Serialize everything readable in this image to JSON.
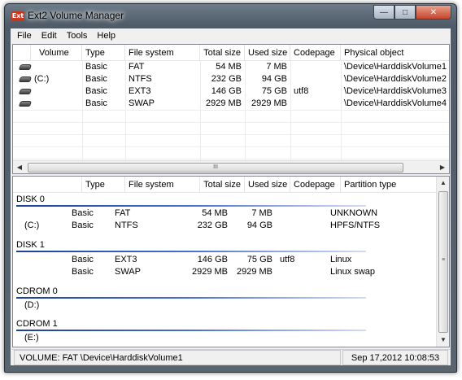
{
  "window": {
    "title": "Ext2 Volume Manager",
    "icon": "ext2-app-icon"
  },
  "caption_buttons": {
    "minimize": "—",
    "maximize": "□",
    "close": "✕"
  },
  "menu": [
    "File",
    "Edit",
    "Tools",
    "Help"
  ],
  "volumes": {
    "columns": [
      "Volume",
      "Type",
      "File system",
      "Total size",
      "Used size",
      "Codepage",
      "Physical object"
    ],
    "rows": [
      {
        "volume": "",
        "type": "Basic",
        "fs": "FAT",
        "total": "54 MB",
        "used": "7 MB",
        "codepage": "",
        "physical": "\\Device\\HarddiskVolume1"
      },
      {
        "volume": "(C:)",
        "type": "Basic",
        "fs": "NTFS",
        "total": "232 GB",
        "used": "94 GB",
        "codepage": "",
        "physical": "\\Device\\HarddiskVolume2"
      },
      {
        "volume": "",
        "type": "Basic",
        "fs": "EXT3",
        "total": "146 GB",
        "used": "75 GB",
        "codepage": "utf8",
        "physical": "\\Device\\HarddiskVolume3"
      },
      {
        "volume": "",
        "type": "Basic",
        "fs": "SWAP",
        "total": "2929 MB",
        "used": "2929 MB",
        "codepage": "",
        "physical": "\\Device\\HarddiskVolume4"
      }
    ],
    "scroll_grip": "III"
  },
  "disks": {
    "columns": [
      "",
      "Type",
      "File system",
      "Total size",
      "Used size",
      "Codepage",
      "Partition type"
    ],
    "groups": [
      {
        "label": "DISK 0",
        "rows": [
          {
            "vol": "",
            "type": "Basic",
            "fs": "FAT",
            "total": "54 MB",
            "used": "7 MB",
            "codepage": "",
            "ptype": "UNKNOWN"
          },
          {
            "vol": "(C:)",
            "type": "Basic",
            "fs": "NTFS",
            "total": "232 GB",
            "used": "94 GB",
            "codepage": "",
            "ptype": "HPFS/NTFS"
          }
        ]
      },
      {
        "label": "DISK 1",
        "rows": [
          {
            "vol": "",
            "type": "Basic",
            "fs": "EXT3",
            "total": "146 GB",
            "used": "75 GB",
            "codepage": "utf8",
            "ptype": "Linux"
          },
          {
            "vol": "",
            "type": "Basic",
            "fs": "SWAP",
            "total": "2929 MB",
            "used": "2929 MB",
            "codepage": "",
            "ptype": "Linux swap"
          }
        ]
      },
      {
        "label": "CDROM 0",
        "rows": [
          {
            "vol": "(D:)",
            "type": "",
            "fs": "",
            "total": "",
            "used": "",
            "codepage": "",
            "ptype": ""
          }
        ]
      },
      {
        "label": "CDROM 1",
        "rows": [
          {
            "vol": "(E:)",
            "type": "",
            "fs": "",
            "total": "",
            "used": "",
            "codepage": "",
            "ptype": ""
          }
        ]
      }
    ],
    "scroll_grip": "≡"
  },
  "status": {
    "left": "VOLUME:  FAT \\Device\\HarddiskVolume1",
    "right": "Sep 17,2012 10:08:53"
  },
  "colors": {
    "group_line": "#1d3f99",
    "title_bg": "#5a6570",
    "close_button": "#c5462d"
  }
}
